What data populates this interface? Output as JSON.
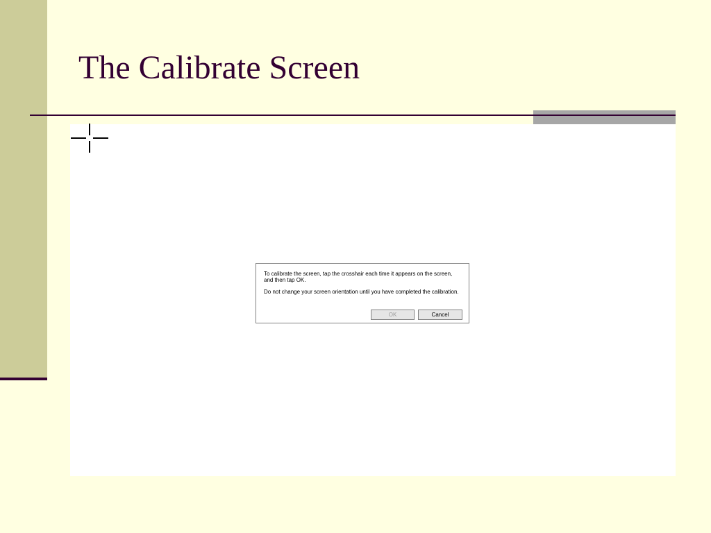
{
  "slide": {
    "title": "The Calibrate Screen"
  },
  "dialog": {
    "paragraph1": "To calibrate the screen, tap the crosshair each time it appears on the screen, and then tap OK.",
    "paragraph2": "Do not change your screen orientation until you have completed the calibration.",
    "ok_label": "OK",
    "cancel_label": "Cancel"
  },
  "icons": {
    "crosshair": "crosshair-icon"
  },
  "colors": {
    "background": "#FFFFE1",
    "left_bar": "#CCCC99",
    "title": "#330033",
    "grey_block": "#A6A6A6",
    "panel": "#FFFFFF"
  }
}
